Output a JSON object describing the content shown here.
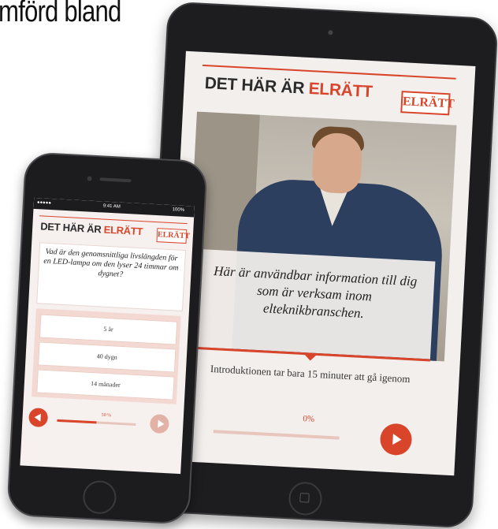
{
  "headline": "mförd bland",
  "tablet": {
    "title_part1": "DET HÄR ÄR ",
    "title_accent": "ELRÄTT",
    "logo_text": "ELRÄTT",
    "quote": "Här är användbar information till dig som är verksam inom elteknikbranschen.",
    "intro": "Introduktionen tar bara 15 minuter att gå igenom",
    "progress_label": "0%",
    "progress_value": 0,
    "play_icon": "play-icon"
  },
  "phone": {
    "status_carrier": "●●●●● ",
    "status_time": "9:41 AM",
    "status_battery": "100%",
    "title_part1": "DET HÄR ÄR ",
    "title_accent": "ELRÄTT",
    "logo_text": "ELRÄTT",
    "question": "Vad är den genomsnittliga livslängden för en LED-lampa om den lyser 24 timmar om dygnet?",
    "answers": [
      "5 år",
      "40 dygn",
      "14 månader"
    ],
    "progress_label": "50 %",
    "progress_value": 0.5,
    "prev_icon": "prev-arrow-icon",
    "next_icon": "next-arrow-icon"
  },
  "colors": {
    "accent": "#d9452b",
    "device": "#1d1d1f",
    "screen_bg": "#f3efed"
  }
}
